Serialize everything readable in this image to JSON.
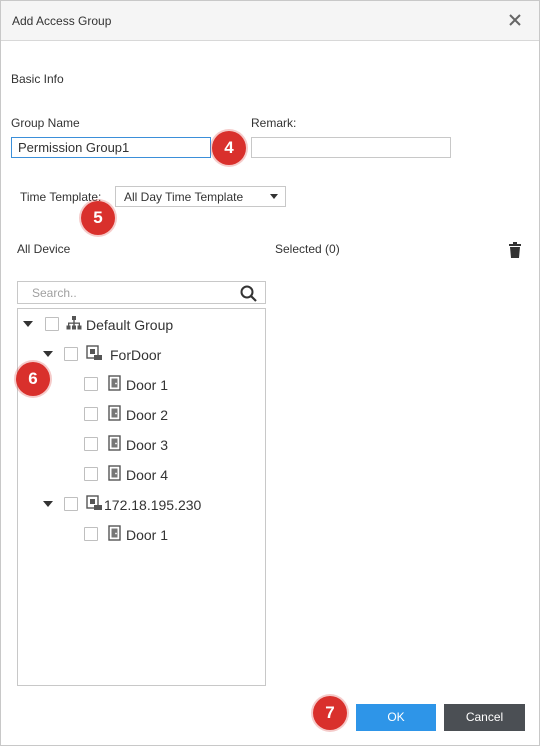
{
  "dialog": {
    "title": "Add Access Group"
  },
  "basic_info": {
    "section_label": "Basic Info",
    "group_name_label": "Group Name",
    "group_name_value": "Permission Group1",
    "remark_label": "Remark:",
    "remark_value": "",
    "time_template_label": "Time Template:",
    "time_template_value": "All Day Time Template"
  },
  "callouts": [
    "4",
    "5",
    "6",
    "7"
  ],
  "device_panel": {
    "all_device_label": "All Device",
    "selected_label": "Selected (0)",
    "search_placeholder": "Search.."
  },
  "tree": [
    {
      "label": "Default Group",
      "icon": "org-tree-icon",
      "level": 0,
      "expandable": true
    },
    {
      "label": "ForDoor",
      "icon": "device-icon",
      "level": 1,
      "expandable": true
    },
    {
      "label": "Door 1",
      "icon": "door-icon",
      "level": 2,
      "expandable": false
    },
    {
      "label": "Door 2",
      "icon": "door-icon",
      "level": 2,
      "expandable": false
    },
    {
      "label": "Door 3",
      "icon": "door-icon",
      "level": 2,
      "expandable": false
    },
    {
      "label": "Door 4",
      "icon": "door-icon",
      "level": 2,
      "expandable": false
    },
    {
      "label": "172.18.195.230",
      "icon": "device-icon",
      "level": 1,
      "expandable": true
    },
    {
      "label": "Door 1",
      "icon": "door-icon",
      "level": 2,
      "expandable": false
    }
  ],
  "buttons": {
    "ok": "OK",
    "cancel": "Cancel"
  },
  "colors": {
    "ok_button": "#2e95e8",
    "cancel_button": "#4b4f54",
    "callout": "#d9302c",
    "active_input_border": "#3b8fd9"
  }
}
